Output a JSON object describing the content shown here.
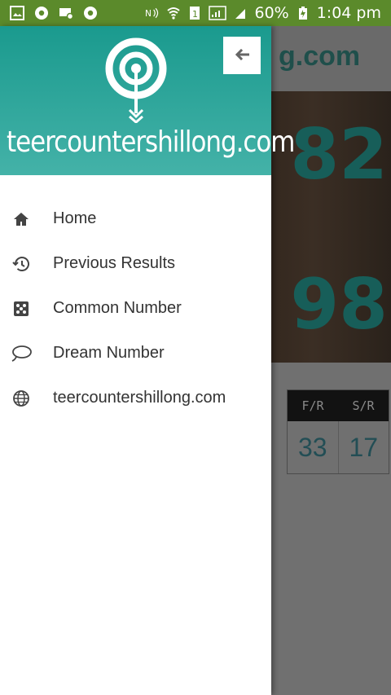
{
  "status_bar": {
    "battery": "60%",
    "time": "1:04 pm"
  },
  "app": {
    "toolbar_text": "g.com",
    "hero": {
      "first_number": "82",
      "second_number": "98"
    },
    "results_table": {
      "headers": [
        "F/R",
        "S/R"
      ],
      "values": [
        "33",
        "17"
      ]
    }
  },
  "drawer": {
    "brand": "teercountershillong.com",
    "menu": [
      {
        "label": "Home",
        "icon": "home-icon"
      },
      {
        "label": "Previous Results",
        "icon": "history-icon"
      },
      {
        "label": "Common Number",
        "icon": "dice-icon"
      },
      {
        "label": "Dream Number",
        "icon": "speech-bubble-icon"
      },
      {
        "label": "teercountershillong.com",
        "icon": "globe-icon"
      }
    ]
  },
  "colors": {
    "status_bar": "#5b8a2b",
    "drawer_header_top": "#1a9a8e",
    "drawer_header_bottom": "#44b2a8"
  }
}
